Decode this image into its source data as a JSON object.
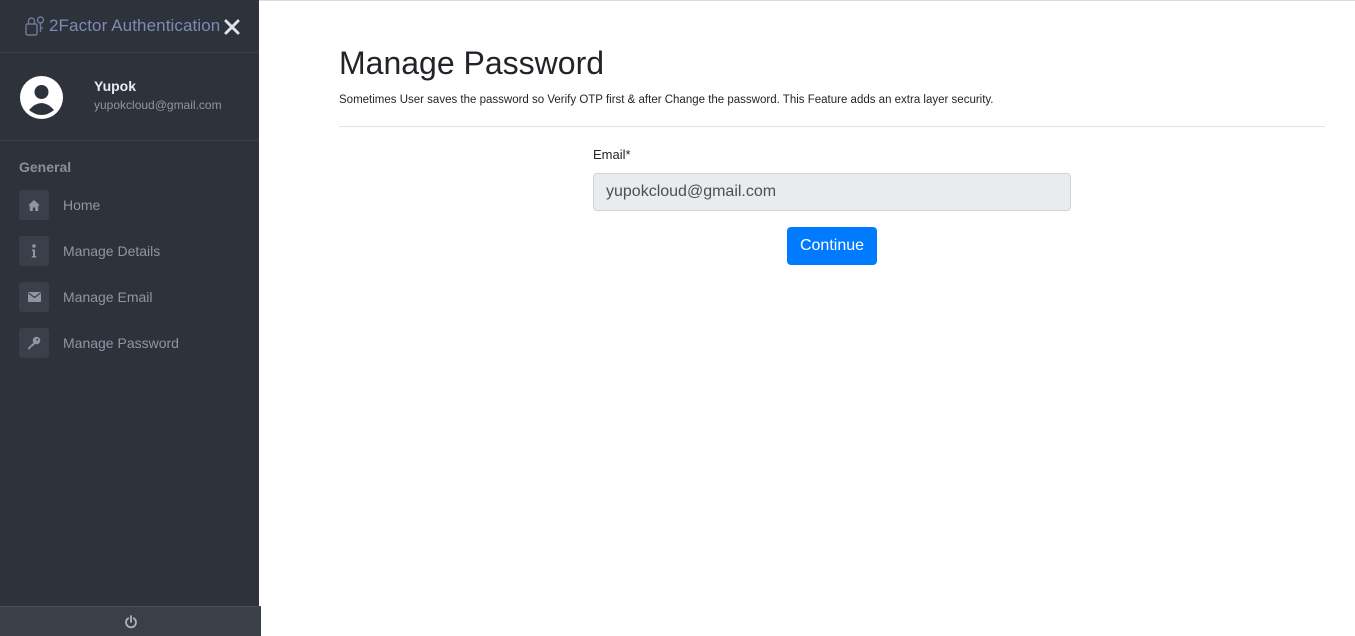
{
  "sidebar": {
    "brand": {
      "title": "2Factor Authentication",
      "logo_icon": "lock-key-icon",
      "close_icon": "close-icon"
    },
    "profile": {
      "name": "Yupok",
      "email": "yupokcloud@gmail.com",
      "avatar_icon": "user-avatar-icon"
    },
    "section_title": "General",
    "items": [
      {
        "label": "Home",
        "icon": "home-icon"
      },
      {
        "label": "Manage Details",
        "icon": "info-icon"
      },
      {
        "label": "Manage Email",
        "icon": "envelope-icon"
      },
      {
        "label": "Manage Password",
        "icon": "key-icon"
      }
    ],
    "footer_icon": "power-icon"
  },
  "main": {
    "title": "Manage Password",
    "description": "Sometimes User saves the password so Verify OTP first & after Change the password. This Feature adds an extra layer security.",
    "form": {
      "email_label": "Email*",
      "email_value": "yupokcloud@gmail.com",
      "continue_label": "Continue"
    }
  },
  "colors": {
    "sidebar_bg": "#2e323b",
    "accent": "#007bff",
    "brand_text": "#7d8bb3",
    "input_bg": "#e9ecef"
  }
}
